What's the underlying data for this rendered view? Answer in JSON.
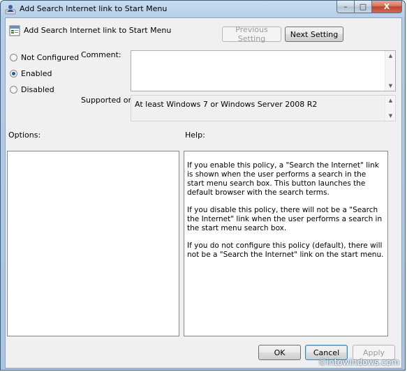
{
  "window": {
    "title": "Add Search Internet link to Start Menu",
    "controls": {
      "minimize": "–",
      "maximize": "□",
      "close": "X"
    }
  },
  "header": {
    "setting_title": "Add Search Internet link to Start Menu",
    "previous_label": "Previous Setting",
    "next_label": "Next Setting"
  },
  "state": {
    "options": [
      {
        "label": "Not Configured",
        "checked": false
      },
      {
        "label": "Enabled",
        "checked": true
      },
      {
        "label": "Disabled",
        "checked": false
      }
    ]
  },
  "comment": {
    "label": "Comment:",
    "value": ""
  },
  "supported": {
    "label": "Supported on:",
    "value": "At least Windows 7 or Windows Server 2008 R2"
  },
  "options_pane": {
    "label": "Options:"
  },
  "help_pane": {
    "label": "Help:",
    "paragraphs": [
      "If you enable this policy, a \"Search the Internet\" link is shown when the user performs a search in the start menu search box. This button launches the default browser with the search terms.",
      "If you disable this policy, there will not be a \"Search the Internet\" link when the user performs a search in the start menu search box.",
      "If you do not configure this policy (default), there will not be a \"Search the Internet\" link on the start menu."
    ]
  },
  "footer": {
    "ok_label": "OK",
    "cancel_label": "Cancel",
    "apply_label": "Apply"
  },
  "watermark": "©intowindows.com",
  "icons": {
    "title": "policy-person-icon",
    "header": "policy-setting-icon",
    "scroll_up": "scroll-up-arrow-icon",
    "scroll_down": "scroll-down-arrow-icon"
  }
}
